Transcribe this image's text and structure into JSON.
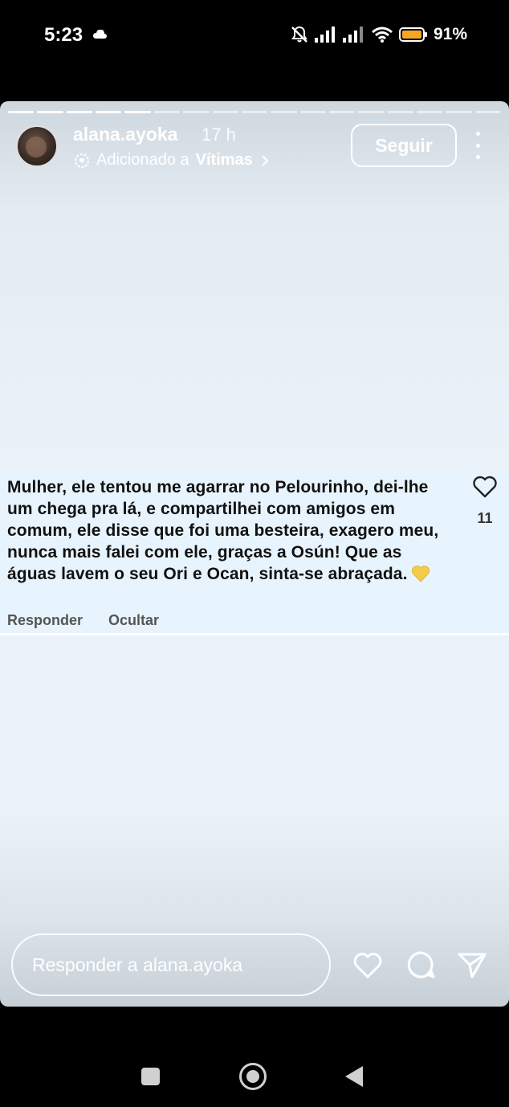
{
  "status_bar": {
    "time": "5:23",
    "battery": "91%",
    "icons": [
      "cloud-icon",
      "mute-icon",
      "signal-icon",
      "signal-icon",
      "wifi-icon",
      "battery-icon"
    ]
  },
  "story": {
    "username": "alana.ayoka",
    "age": "17 h",
    "added_prefix": "Adicionado a",
    "added_highlight": "Vítimas",
    "follow_label": "Seguir",
    "segments_total": 17,
    "segments_done": 5
  },
  "comment": {
    "text": "Mulher, ele tentou me agarrar no Pelourinho, dei-lhe um chega pra lá, e compartilhei com amigos em comum, ele disse que foi uma besteira, exagero meu, nunca mais falei com ele, graças a Osún! Que as águas lavem o seu Ori e Ocan, sinta-se abraçada.",
    "likes": "11",
    "reply_label": "Responder",
    "hide_label": "Ocultar",
    "emoji": "yellow-heart"
  },
  "bottom": {
    "reply_placeholder": "Responder a alana.ayoka"
  },
  "colors": {
    "comment_bg": "#e8f4fd",
    "emoji_heart": "#f5cc4a"
  }
}
